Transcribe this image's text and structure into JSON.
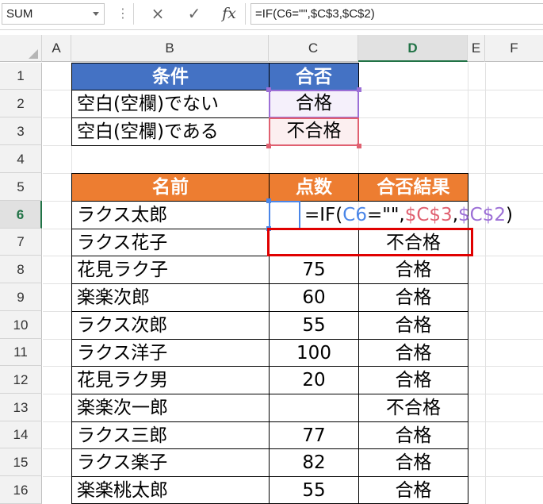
{
  "formula_bar": {
    "name_box": "SUM",
    "cancel_icon": "×",
    "enter_icon": "✓",
    "fx_icon": "fx",
    "formula": "=IF(C6=\"\",$C$3,$C$2)"
  },
  "columns": [
    "A",
    "B",
    "C",
    "D",
    "E",
    "F"
  ],
  "active_column": "D",
  "rows": [
    "1",
    "2",
    "3",
    "4",
    "5",
    "6",
    "7",
    "8",
    "9",
    "10",
    "11",
    "12",
    "13",
    "14",
    "15",
    "16"
  ],
  "active_row": "6",
  "condition_table": {
    "header_condition": "条件",
    "header_result": "合否",
    "rows": [
      {
        "condition": "空白(空欄)でない",
        "result": "合格"
      },
      {
        "condition": "空白(空欄)である",
        "result": "不合格"
      }
    ]
  },
  "score_table": {
    "header_name": "名前",
    "header_score": "点数",
    "header_result": "合否結果",
    "rows": [
      {
        "name": "ラクス太郎",
        "score": "",
        "result": ""
      },
      {
        "name": "ラクス花子",
        "score": "",
        "result": "不合格"
      },
      {
        "name": "花見ラク子",
        "score": "75",
        "result": "合格"
      },
      {
        "name": "楽楽次郎",
        "score": "60",
        "result": "合格"
      },
      {
        "name": "ラクス次郎",
        "score": "55",
        "result": "合格"
      },
      {
        "name": "ラクス洋子",
        "score": "100",
        "result": "合格"
      },
      {
        "name": "花見ラク男",
        "score": "20",
        "result": "合格"
      },
      {
        "name": "楽楽次一郎",
        "score": "",
        "result": "不合格"
      },
      {
        "name": "ラクス三郎",
        "score": "77",
        "result": "合格"
      },
      {
        "name": "ラクス楽子",
        "score": "82",
        "result": "合格"
      },
      {
        "name": "楽楽桃太郎",
        "score": "55",
        "result": "合格"
      }
    ]
  },
  "in_cell_formula": {
    "part1": "=IF(",
    "ref_c6": "C6",
    "part2": "=\"\",",
    "ref_c3": "$C$3",
    "comma": ",",
    "ref_c2": "$C$2",
    "close": ")"
  },
  "colors": {
    "header_blue": "#4472c4",
    "header_orange": "#ed7d31",
    "ref_blue": "#4a86e8",
    "ref_red": "#e06070",
    "ref_purple": "#9c6fd6",
    "highlight_red": "#e00000",
    "excel_green": "#217346"
  }
}
